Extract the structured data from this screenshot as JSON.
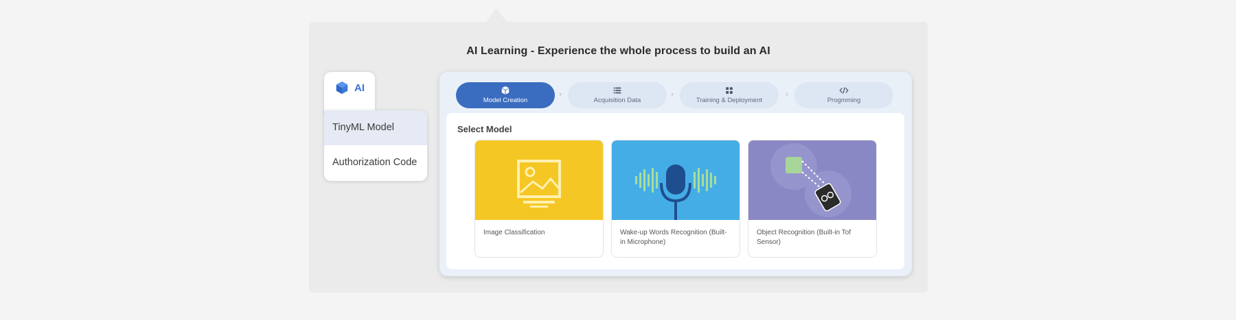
{
  "headline": "AI Learning - Experience the whole process to build an AI",
  "menu": {
    "tab_label": "AI",
    "items": [
      {
        "label": "TinyML Model"
      },
      {
        "label": "Authorization Code"
      }
    ]
  },
  "steps": [
    {
      "label": "Model Creation",
      "icon": "cube-icon"
    },
    {
      "label": "Acquisition Data",
      "icon": "list-icon"
    },
    {
      "label": "Training & Deployment",
      "icon": "grid-icon"
    },
    {
      "label": "Progmming",
      "icon": "code-icon"
    }
  ],
  "select_title": "Select Model",
  "models": [
    {
      "label": "Image Classification",
      "color": "#f5c724"
    },
    {
      "label": "Wake-up Words Recognition (Built-in Microphone)",
      "color": "#45ade6"
    },
    {
      "label": "Object Recognition (Built-in Tof Sensor)",
      "color": "#8a88c4"
    }
  ],
  "colors": {
    "accent": "#3a6cc0",
    "tab_accent": "#3a72d9"
  }
}
